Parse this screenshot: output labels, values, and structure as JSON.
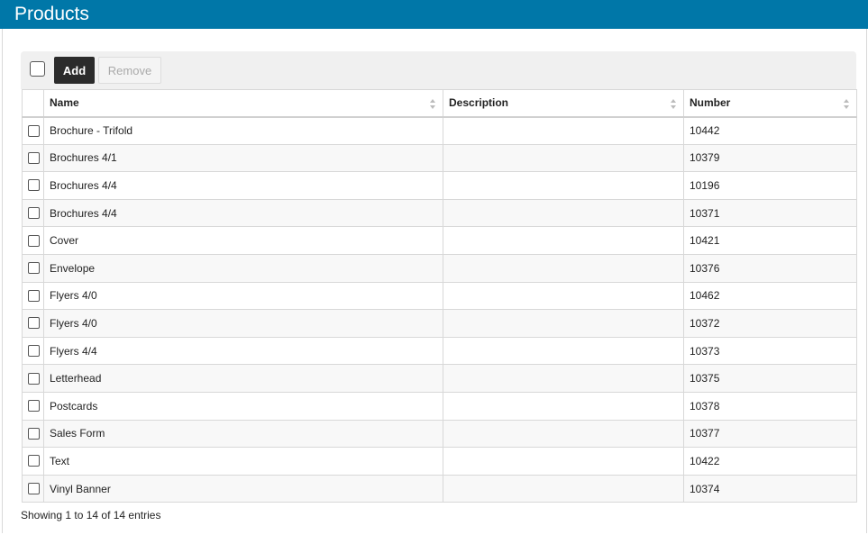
{
  "header": {
    "title": "Products"
  },
  "toolbar": {
    "add_label": "Add",
    "remove_label": "Remove"
  },
  "table": {
    "columns": [
      "Name",
      "Description",
      "Number"
    ],
    "rows": [
      {
        "name": "Brochure - Trifold",
        "description": "",
        "number": "10442"
      },
      {
        "name": "Brochures 4/1",
        "description": "",
        "number": "10379"
      },
      {
        "name": "Brochures 4/4",
        "description": "",
        "number": "10196"
      },
      {
        "name": "Brochures 4/4",
        "description": "",
        "number": "10371"
      },
      {
        "name": "Cover",
        "description": "",
        "number": "10421"
      },
      {
        "name": "Envelope",
        "description": "",
        "number": "10376"
      },
      {
        "name": "Flyers 4/0",
        "description": "",
        "number": "10462"
      },
      {
        "name": "Flyers 4/0",
        "description": "",
        "number": "10372"
      },
      {
        "name": "Flyers 4/4",
        "description": "",
        "number": "10373"
      },
      {
        "name": "Letterhead",
        "description": "",
        "number": "10375"
      },
      {
        "name": "Postcards",
        "description": "",
        "number": "10378"
      },
      {
        "name": "Sales Form",
        "description": "",
        "number": "10377"
      },
      {
        "name": "Text",
        "description": "",
        "number": "10422"
      },
      {
        "name": "Vinyl Banner",
        "description": "",
        "number": "10374"
      }
    ]
  },
  "footer": {
    "info": "Showing 1 to 14 of 14 entries"
  },
  "colors": {
    "header_bg": "#0077a8",
    "add_button_bg": "#2b2b2b"
  },
  "icons": {
    "sort": "sort-icon",
    "checkbox": "checkbox-icon"
  }
}
